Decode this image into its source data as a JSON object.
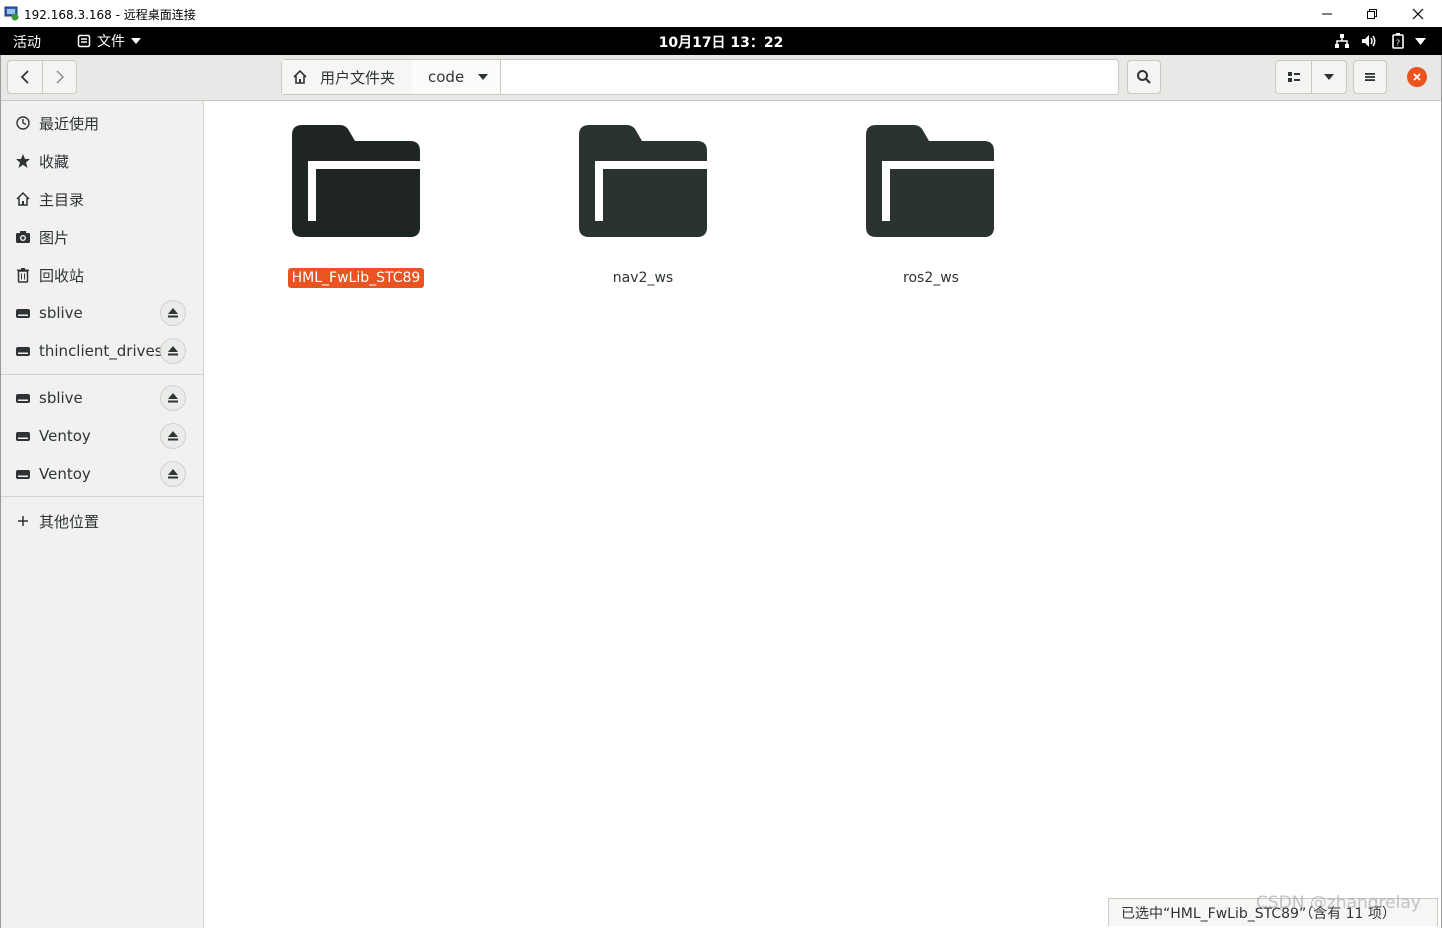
{
  "rdp": {
    "title": "192.168.3.168 - 远程桌面连接"
  },
  "topbar": {
    "activities": "活动",
    "app_menu": "文件",
    "clock": "10月17日 13：22"
  },
  "header": {
    "path": [
      {
        "label": "用户文件夹",
        "icon": "home-icon"
      },
      {
        "label": "code",
        "icon": "chevron-down-icon"
      }
    ]
  },
  "sidebar": {
    "places": [
      {
        "label": "最近使用",
        "icon": "clock-icon"
      },
      {
        "label": "收藏",
        "icon": "star-icon"
      },
      {
        "label": "主目录",
        "icon": "home-icon"
      },
      {
        "label": "图片",
        "icon": "camera-icon"
      },
      {
        "label": "回收站",
        "icon": "trash-icon"
      },
      {
        "label": "sblive",
        "icon": "drive-icon",
        "eject": true
      },
      {
        "label": "thinclient_drives",
        "icon": "drive-icon",
        "eject": true
      }
    ],
    "devices": [
      {
        "label": "sblive",
        "icon": "drive-icon",
        "eject": true
      },
      {
        "label": "Ventoy",
        "icon": "drive-icon",
        "eject": true
      },
      {
        "label": "Ventoy",
        "icon": "drive-icon",
        "eject": true
      }
    ],
    "other": {
      "label": "其他位置",
      "icon": "plus-icon"
    }
  },
  "files": [
    {
      "name": "HML_FwLib_STC89",
      "selected": true
    },
    {
      "name": "nav2_ws",
      "selected": false
    },
    {
      "name": "ros2_ws",
      "selected": false
    }
  ],
  "status": "已选中“HML_FwLib_STC89”（含有 11 项）",
  "watermark": "CSDN @zhangrelay",
  "colors": {
    "accent": "#e95420",
    "folder": "#2b3330",
    "sidebar_bg": "#f1f1f1",
    "header_bg": "#e8e8e7",
    "topbar_bg": "#000000"
  }
}
